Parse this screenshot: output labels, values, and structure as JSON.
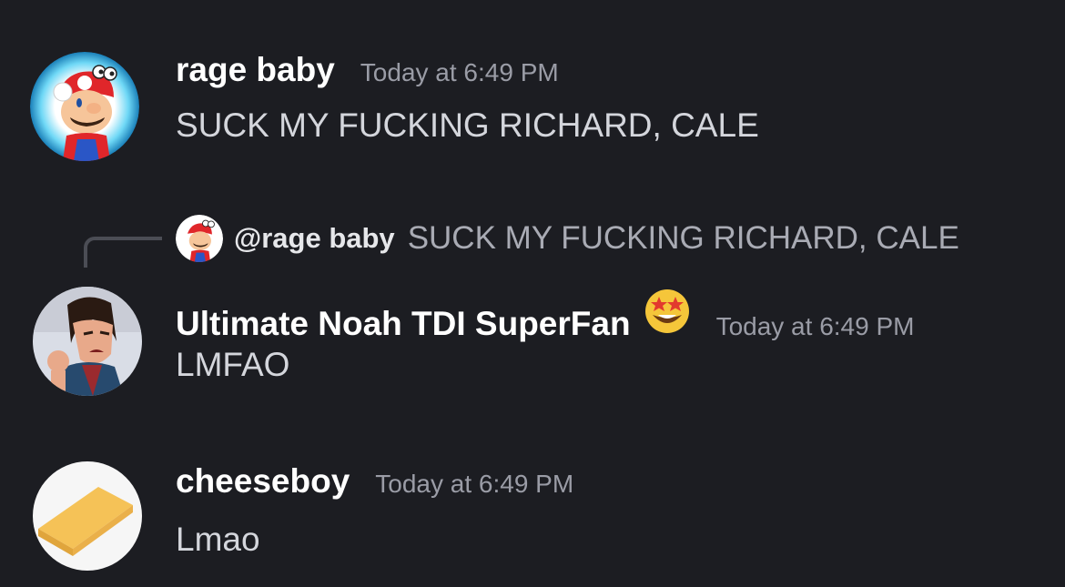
{
  "messages": [
    {
      "username": "rage baby",
      "timestamp": "Today at 6:49 PM",
      "content": "SUCK MY FUCKING RICHARD, CALE",
      "avatar_icon": "mario-avatar-icon"
    },
    {
      "reply": {
        "mention": "@rage baby",
        "preview": "SUCK MY FUCKING RICHARD, CALE",
        "avatar_icon": "mario-avatar-icon"
      },
      "username": "Ultimate Noah TDI SuperFan",
      "username_emoji": "star-struck-emoji-icon",
      "timestamp": "Today at 6:49 PM",
      "content": "LMFAO",
      "avatar_icon": "cartoon-character-avatar-icon"
    },
    {
      "username": "cheeseboy",
      "timestamp": "Today at 6:49 PM",
      "content": "Lmao",
      "avatar_icon": "cheese-avatar-icon"
    }
  ],
  "colors": {
    "background": "#1c1d22",
    "username": "#ffffff",
    "timestamp": "#9a9ca6",
    "content": "#d4d6dc",
    "reply_spine": "#4b4d55",
    "avatar_glow": "#3ec8f0",
    "mario_red": "#e0262a"
  }
}
